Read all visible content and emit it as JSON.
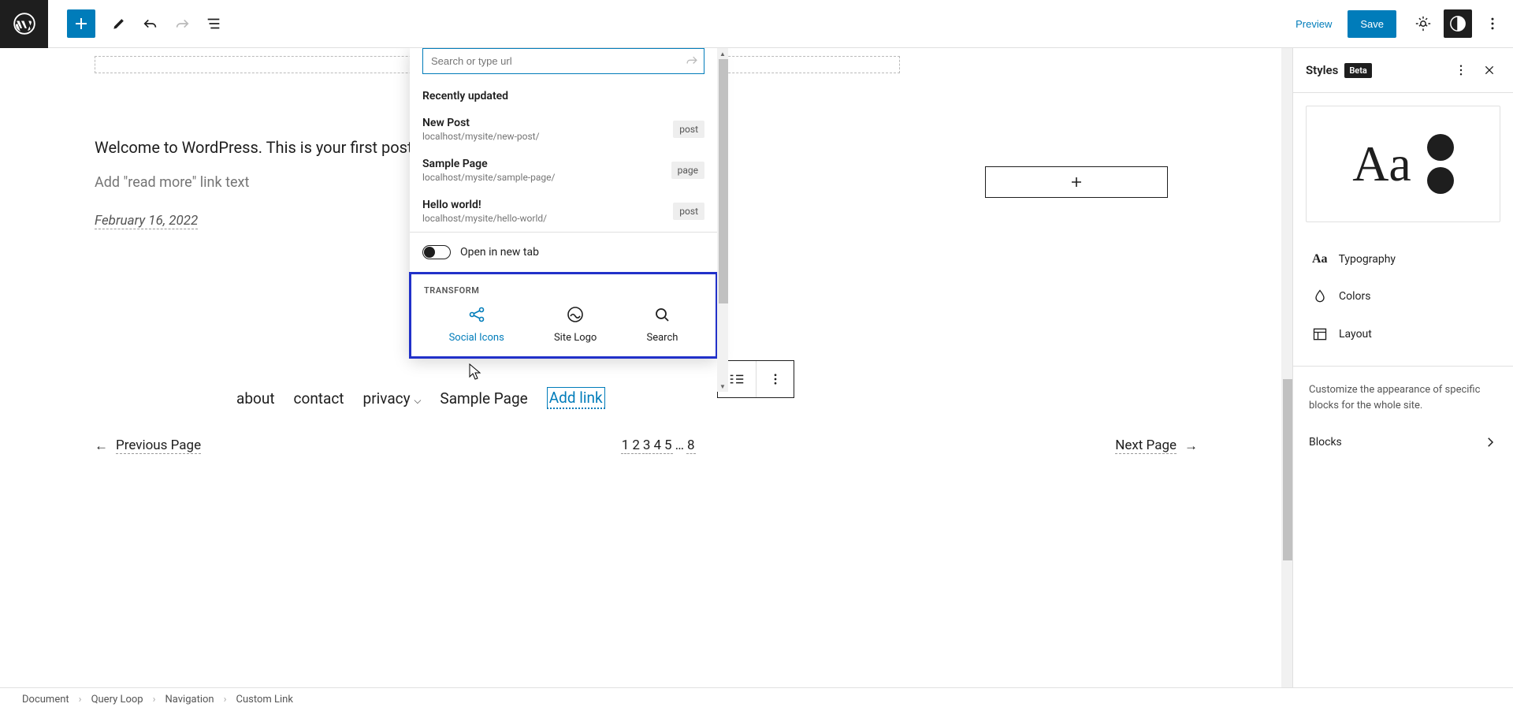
{
  "topbar": {
    "preview": "Preview",
    "save": "Save"
  },
  "canvas": {
    "post_text": "Welcome to WordPress. This is your first post. Edi",
    "read_more": "Add \"read more\" link text",
    "date": "February 16, 2022"
  },
  "popover": {
    "search_placeholder": "Search or type url",
    "recent_label": "Recently updated",
    "results": [
      {
        "title": "New Post",
        "url": "localhost/mysite/new-post/",
        "type": "post"
      },
      {
        "title": "Sample Page",
        "url": "localhost/mysite/sample-page/",
        "type": "page"
      },
      {
        "title": "Hello world!",
        "url": "localhost/mysite/hello-world/",
        "type": "post"
      }
    ],
    "new_tab": "Open in new tab",
    "transform_label": "TRANSFORM",
    "transforms": [
      {
        "label": "Social Icons"
      },
      {
        "label": "Site Logo"
      },
      {
        "label": "Search"
      }
    ]
  },
  "nav": {
    "items": [
      "about",
      "contact",
      "privacy",
      "Sample Page"
    ],
    "add_link": "Add link"
  },
  "pagination": {
    "prev": "Previous Page",
    "next": "Next Page",
    "numbers": [
      "1",
      "2",
      "3",
      "4",
      "5",
      "…",
      "8"
    ]
  },
  "sidebar": {
    "title": "Styles",
    "beta": "Beta",
    "preview_text": "Aa",
    "typography": "Typography",
    "colors": "Colors",
    "layout": "Layout",
    "desc": "Customize the appearance of specific blocks for the whole site.",
    "blocks": "Blocks"
  },
  "breadcrumb": [
    "Document",
    "Query Loop",
    "Navigation",
    "Custom Link"
  ]
}
